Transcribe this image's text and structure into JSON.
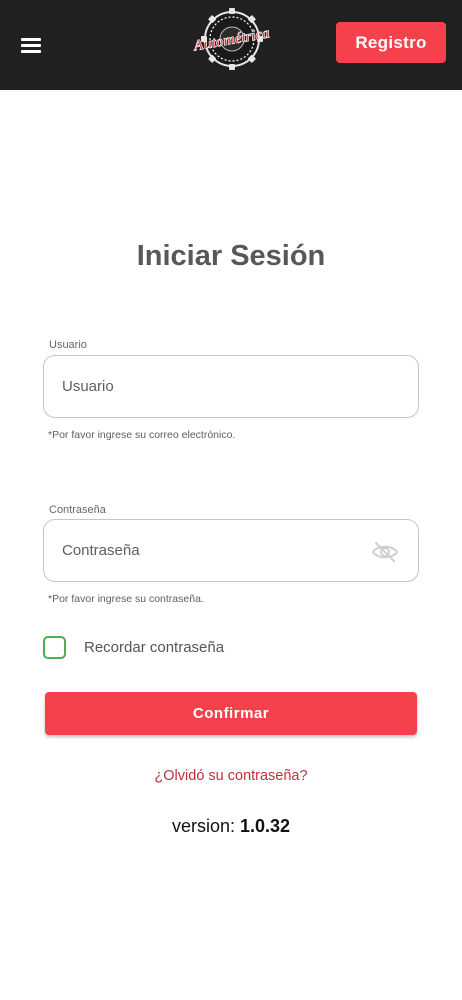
{
  "header": {
    "logo_text": "Autométrica",
    "register_label": "Registro",
    "background": "#212121",
    "accent": "#f4414c",
    "menu_icon": "hamburger-menu-icon"
  },
  "login": {
    "title": "Iniciar Sesión",
    "username": {
      "label": "Usuario",
      "placeholder": "Usuario",
      "value": "",
      "hint": "*Por favor ingrese su correo electrónico."
    },
    "password": {
      "label": "Contraseña",
      "placeholder": "Contraseña",
      "value": "",
      "hint": "*Por favor ingrese su contraseña.",
      "toggle_icon": "eye-off-icon"
    },
    "remember_label": "Recordar contraseña",
    "remember_checked": false,
    "checkbox_color": "#4caf50",
    "confirm_label": "Confirmar",
    "forgot_label": "¿Olvidó su contraseña?",
    "forgot_color": "#c0303a"
  },
  "footer": {
    "version_prefix": "version:",
    "version_number": "1.0.32"
  }
}
